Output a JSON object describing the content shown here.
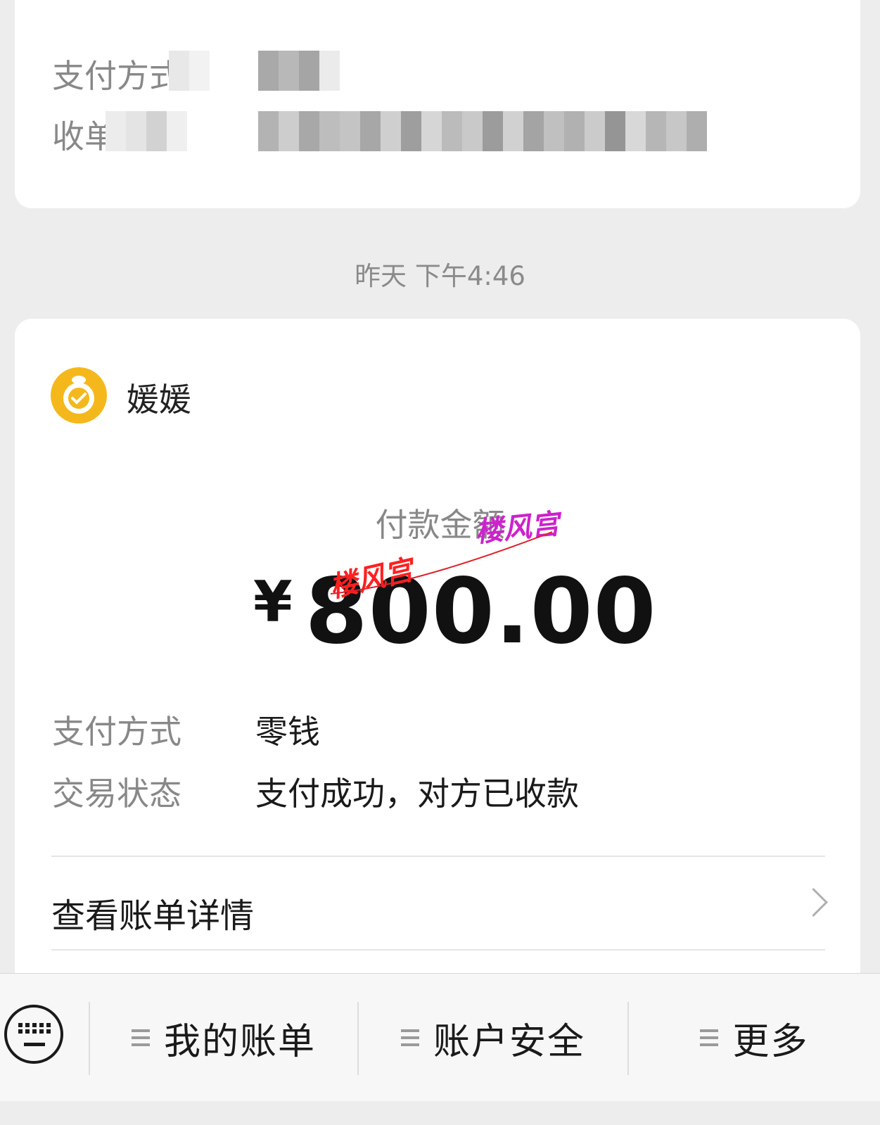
{
  "top_card": {
    "rows": [
      {
        "label": "支付方式"
      },
      {
        "label": "收单机构"
      }
    ]
  },
  "timestamp": "昨天 下午4:46",
  "payment": {
    "merchant_name": "媛媛",
    "amount_label": "付款金额",
    "currency_symbol": "¥",
    "amount": "800.00",
    "watermark_text": "楼风宫",
    "details": [
      {
        "label": "支付方式",
        "value": "零钱"
      },
      {
        "label": "交易状态",
        "value": "支付成功，对方已收款"
      }
    ],
    "view_bill_label": "查看账单详情"
  },
  "bottom_menu": {
    "keyboard_icon": "keyboard-icon",
    "items": [
      {
        "label": "我的账单",
        "icon": "menu-lines-icon"
      },
      {
        "label": "账户安全",
        "icon": "menu-lines-icon"
      },
      {
        "label": "更多",
        "icon": "menu-lines-icon"
      }
    ]
  },
  "colors": {
    "background": "#ededed",
    "card": "#ffffff",
    "avatar": "#f5b81c",
    "watermark_red": "#ff2020",
    "watermark_magenta": "#cc22cc"
  }
}
